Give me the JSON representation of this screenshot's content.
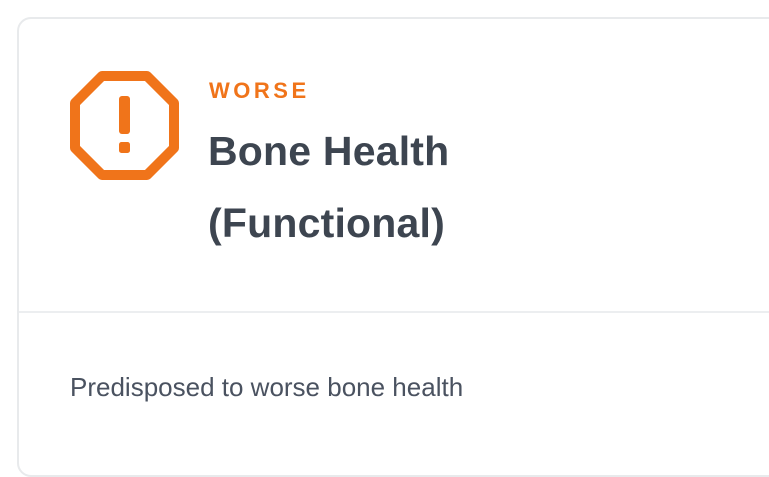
{
  "card": {
    "status": "WORSE",
    "title_line1": "Bone Health",
    "title_line2": "(Functional)",
    "description": "Predisposed to worse bone health",
    "status_icon": "warning-octagon-icon",
    "accent_color": "#f0741a"
  }
}
